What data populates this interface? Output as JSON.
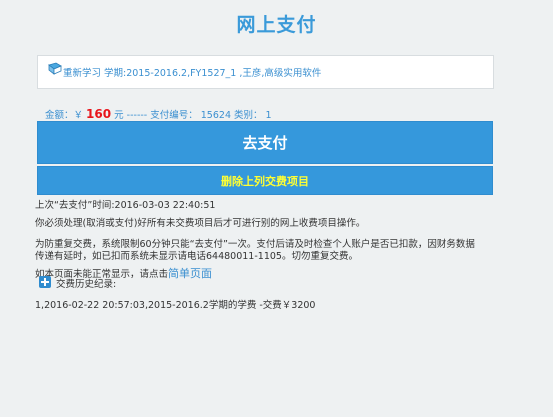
{
  "header": {
    "title": "网上支付"
  },
  "course": {
    "icon": "book-icon",
    "text": "重新学习 学期:2015-2016.2,FY1527_1 ,王彦,高级实用软件"
  },
  "payment": {
    "amount_prefix": "金额：￥",
    "amount": "160",
    "amount_suffix": "元 ------ 支付编号： 15624 类别： 1"
  },
  "buttons": {
    "pay_label": "去支付",
    "delete_label": "删除上列交费项目"
  },
  "info": {
    "last_pay": "上次“去支付”时间:2016-03-03 22:40:51",
    "notice1": "你必须处理(取消或支付)好所有未交费项目后才可进行别的网上收费项目操作。",
    "notice2": "为防重复交费，系统限制60分钟只能“去支付”一次。支付后请及时检查个人账户是否已扣款，因财务数据",
    "notice3": "传递有延时，如已扣而系统未显示请电话64480011-1105。切勿重复交费。",
    "simple_prefix": "如本页面未能正常显示，请点击",
    "simple_link": "简单页面"
  },
  "history": {
    "icon": "plus-icon",
    "label": "交费历史纪录:",
    "records": [
      "1,2016-02-22 20:57:03,2015-2016.2学期的学费 -交费￥3200"
    ]
  },
  "colors": {
    "accent": "#3598dc",
    "amount": "#e8141b",
    "delete_text": "#ffff33",
    "link": "#3a8fd0"
  }
}
